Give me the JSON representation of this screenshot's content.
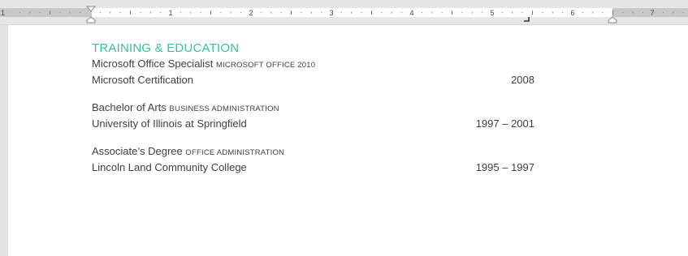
{
  "ruler": {
    "leading_label": "1",
    "numbers": [
      "1",
      "2",
      "3",
      "4",
      "5",
      "6",
      "7"
    ]
  },
  "section": {
    "heading": "TRAINING & EDUCATION",
    "entries": [
      {
        "title": "Microsoft Office Specialist",
        "title_sub": "MICROSOFT OFFICE 2010",
        "institution": "Microsoft Certification",
        "date": "2008"
      },
      {
        "title": "Bachelor of Arts",
        "title_sub": "BUSINESS ADMINISTRATION",
        "institution": "University of Illinois at Springfield",
        "date": "1997 – 2001"
      },
      {
        "title": "Associate’s Degree",
        "title_sub": "OFFICE ADMINISTRATION",
        "institution": "Lincoln Land Community College",
        "date": "1995 – 1997"
      }
    ]
  },
  "colors": {
    "heading_accent": "#3fbc9b",
    "body_text": "#404040"
  }
}
